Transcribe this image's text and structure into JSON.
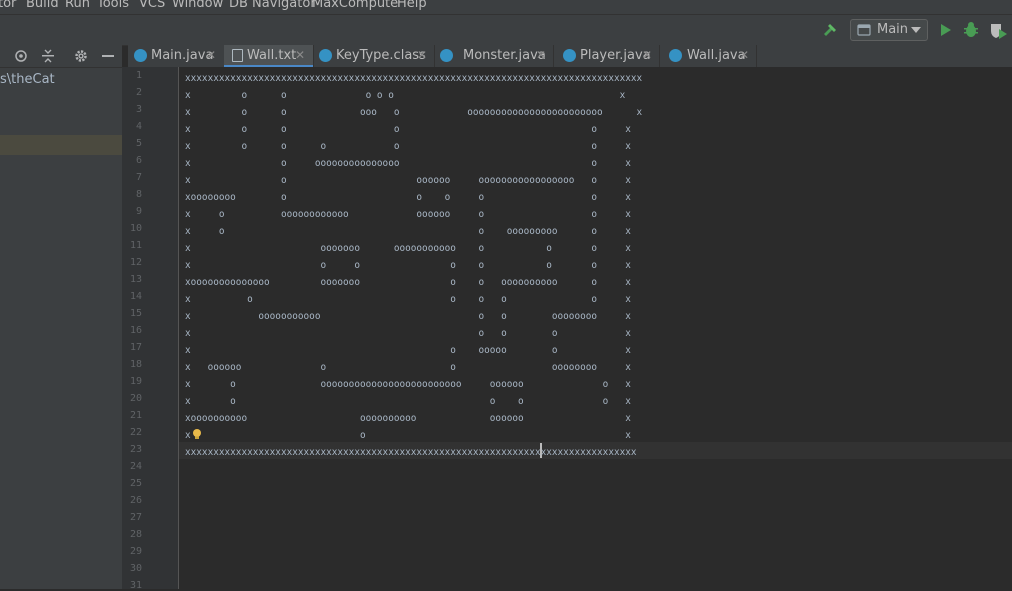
{
  "menu": {
    "items": [
      "tor",
      "Build",
      "Run",
      "Tools",
      "VCS",
      "Window",
      "DB Navigator",
      "MaxCompute",
      "Help"
    ]
  },
  "toolbar": {
    "run_config": "Main",
    "icons": [
      "build-icon",
      "dropdown-icon",
      "run-icon",
      "debug-icon",
      "coverage-icon"
    ]
  },
  "side_panel": {
    "path_text": "s\\theCat",
    "icons": [
      "locate-icon",
      "collapse-icon",
      "gear-icon",
      "minimize-icon"
    ]
  },
  "tabs": [
    {
      "label": "Main.java",
      "icon": "java-class-icon",
      "active": false
    },
    {
      "label": "Wall.txt",
      "icon": "text-file-icon",
      "active": true
    },
    {
      "label": "KeyType.class",
      "icon": "compiled-class-icon",
      "active": false
    },
    {
      "label": "Monster.java",
      "icon": "java-class-icon",
      "active": false
    },
    {
      "label": "Player.java",
      "icon": "java-class-icon",
      "active": false
    },
    {
      "label": "Wall.java",
      "icon": "java-class-icon",
      "active": false
    }
  ],
  "editor": {
    "line_numbers": [
      "1",
      "2",
      "3",
      "4",
      "5",
      "6",
      "7",
      "8",
      "9",
      "10",
      "11",
      "12",
      "13",
      "14",
      "15",
      "16",
      "17",
      "18",
      "19",
      "20",
      "21",
      "22",
      "23",
      "24",
      "25",
      "26",
      "27",
      "28",
      "29",
      "30",
      "31"
    ],
    "lines": [
      "xxxxxxxxxxxxxxxxxxxxxxxxxxxxxxxxxxxxxxxxxxxxxxxxxxxxxxxxxxxxxxxxxxxxxxxxxxxxxxxxx",
      "x         o      o              o o o                                        x",
      "x         o      o             ooo   o            oooooooooooooooooooooooo      x",
      "x         o      o                   o                                  o     x",
      "x         o      o      o            o                                  o     x",
      "x                o     ooooooooooooooo                                  o     x",
      "x                o                       oooooo     ooooooooooooooooo   o     x",
      "xoooooooo        o                       o    o     o                   o     x",
      "x     o          oooooooooooo            oooooo     o                   o     x",
      "x     o                                             o    ooooooooo      o     x",
      "x                       ooooooo      ooooooooooo    o           o       o     x",
      "x                       o     o                o    o           o       o     x",
      "xoooooooooooooo         ooooooo                o    o   oooooooooo      o     x",
      "x          o                                   o    o   o               o     x",
      "x            ooooooooooo                            o   o        oooooooo     x",
      "x                                                   o   o        o            x",
      "x                                              o    ooooo        o            x",
      "x   oooooo              o                      o                 oooooooo     x",
      "x       o               ooooooooooooooooooooooooo     oooooo              o   x",
      "x       o                                             o    o              o   x",
      "xoooooooooo                    oooooooooo             oooooo                  x",
      "x                              o                                              x",
      "xxxxxxxxxxxxxxxxxxxxxxxxxxxxxxxxxxxxxxxxxxxxxxxxxxxxxxxxxxxxxxxxxxxxxxxxxxxxxxxx",
      "",
      "",
      "",
      "",
      "",
      "",
      "",
      ""
    ]
  },
  "colors": {
    "editor_bg": "#2b2b2b",
    "chrome_bg": "#3c3f41",
    "accent": "#4a88c7",
    "run_green": "#499c54"
  }
}
